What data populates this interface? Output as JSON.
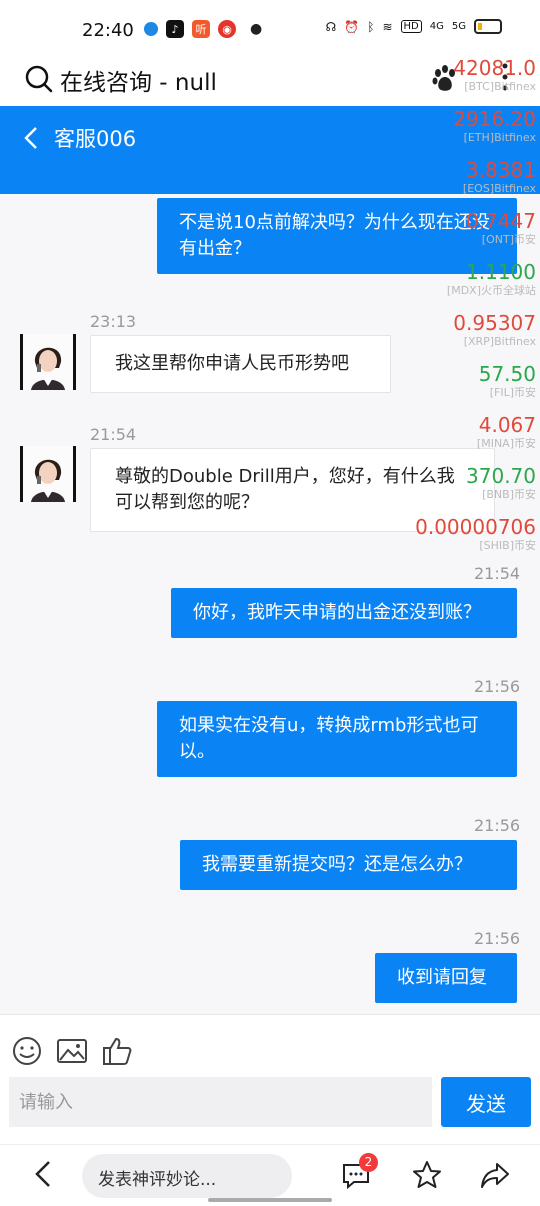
{
  "status_bar": {
    "time": "22:40",
    "app_badge": "听",
    "hd_label": "HD",
    "net_a": "4G",
    "net_b": "5G"
  },
  "browser": {
    "title": "在线咨询 - null"
  },
  "chat": {
    "title": "客服006"
  },
  "messages": [
    {
      "from": "user",
      "text": "不是说10点前解决吗？为什么现在还没有出金？"
    },
    {
      "time": "23:13"
    },
    {
      "from": "agent",
      "text": "我这里帮你申请人民币形势吧"
    },
    {
      "time": "21:54"
    },
    {
      "from": "agent",
      "text": "尊敬的Double Drill用户，您好，有什么我可以帮到您的呢？"
    },
    {
      "time": "21:54"
    },
    {
      "from": "user",
      "text": "你好，我昨天申请的出金还没到账？"
    },
    {
      "time": "21:56"
    },
    {
      "from": "user",
      "text": "如果实在没有u，转换成rmb形式也可以。"
    },
    {
      "time": "21:56"
    },
    {
      "from": "user",
      "text": "我需要重新提交吗？还是怎么办？"
    },
    {
      "time": "21:56"
    },
    {
      "from": "user",
      "text": "收到请回复"
    }
  ],
  "tickers": [
    {
      "value": "42081.0",
      "label": "[BTC]Bitfinex",
      "color": "#e04a3a"
    },
    {
      "value": "2916.20",
      "label": "[ETH]Bitfinex",
      "color": "#e04a3a"
    },
    {
      "value": "3.8381",
      "label": "[EOS]Bitfinex",
      "color": "#e04a3a"
    },
    {
      "value": "0.7447",
      "label": "[ONT]币安",
      "color": "#e04a3a"
    },
    {
      "value": "1.1100",
      "label": "[MDX]火币全球站",
      "color": "#2aa84a"
    },
    {
      "value": "0.95307",
      "label": "[XRP]Bitfinex",
      "color": "#e04a3a"
    },
    {
      "value": "57.50",
      "label": "[FIL]币安",
      "color": "#2aa84a"
    },
    {
      "value": "4.067",
      "label": "[MINA]币安",
      "color": "#e04a3a"
    },
    {
      "value": "370.70",
      "label": "[BNB]币安",
      "color": "#2aa84a"
    },
    {
      "value": "0.00000706",
      "label": "[SHIB]币安",
      "color": "#e04a3a"
    }
  ],
  "composer": {
    "placeholder": "请输入",
    "send_label": "发送"
  },
  "bottom_bar": {
    "comment_placeholder": "发表神评妙论...",
    "comment_count": "2"
  }
}
